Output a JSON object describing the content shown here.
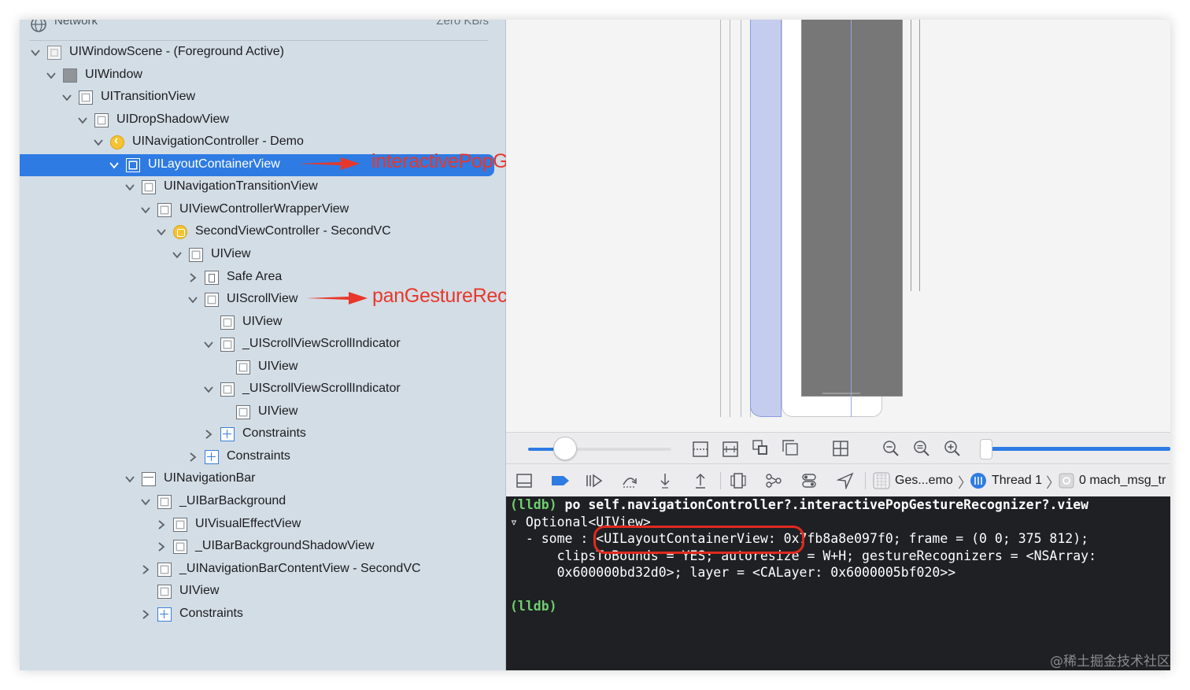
{
  "navigator": {
    "header_label": "Network",
    "header_value": "Zero KB/s",
    "tree": [
      {
        "label": "UIWindowScene - (Foreground Active)",
        "icon": "scene-square",
        "disclosure": "expanded",
        "selected": false
      },
      {
        "label": "UIWindow",
        "icon": "window-square",
        "disclosure": "expanded",
        "selected": false
      },
      {
        "label": "UITransitionView",
        "icon": "view-square",
        "disclosure": "expanded",
        "selected": false
      },
      {
        "label": "UIDropShadowView",
        "icon": "view-square",
        "disclosure": "expanded",
        "selected": false
      },
      {
        "label": "UINavigationController - Demo",
        "icon": "navigation-controller-icon",
        "disclosure": "expanded",
        "selected": false
      },
      {
        "label": "UILayoutContainerView",
        "icon": "view-square",
        "disclosure": "expanded",
        "selected": true
      },
      {
        "label": "UINavigationTransitionView",
        "icon": "view-square",
        "disclosure": "expanded",
        "selected": false
      },
      {
        "label": "UIViewControllerWrapperView",
        "icon": "view-square",
        "disclosure": "expanded",
        "selected": false
      },
      {
        "label": "SecondViewController - SecondVC",
        "icon": "view-controller-icon",
        "disclosure": "expanded",
        "selected": false
      },
      {
        "label": "UIView",
        "icon": "view-square",
        "disclosure": "expanded",
        "selected": false
      },
      {
        "label": "Safe Area",
        "icon": "safe-area-icon",
        "disclosure": "collapsed",
        "selected": false
      },
      {
        "label": "UIScrollView",
        "icon": "view-square",
        "disclosure": "expanded",
        "selected": false
      },
      {
        "label": "UIView",
        "icon": "view-square",
        "disclosure": "none",
        "selected": false
      },
      {
        "label": "_UIScrollViewScrollIndicator",
        "icon": "view-square",
        "disclosure": "expanded",
        "selected": false
      },
      {
        "label": "UIView",
        "icon": "view-square",
        "disclosure": "none",
        "selected": false
      },
      {
        "label": "_UIScrollViewScrollIndicator",
        "icon": "view-square",
        "disclosure": "expanded",
        "selected": false
      },
      {
        "label": "UIView",
        "icon": "view-square",
        "disclosure": "none",
        "selected": false
      },
      {
        "label": "Constraints",
        "icon": "constraints-icon",
        "disclosure": "collapsed",
        "selected": false
      },
      {
        "label": "Constraints",
        "icon": "constraints-icon",
        "disclosure": "collapsed",
        "selected": false
      },
      {
        "label": "UINavigationBar",
        "icon": "navigation-bar-icon",
        "disclosure": "expanded",
        "selected": false
      },
      {
        "label": "_UIBarBackground",
        "icon": "view-square",
        "disclosure": "expanded",
        "selected": false
      },
      {
        "label": "UIVisualEffectView",
        "icon": "view-square",
        "disclosure": "collapsed",
        "selected": false
      },
      {
        "label": "_UIBarBackgroundShadowView",
        "icon": "view-square",
        "disclosure": "collapsed",
        "selected": false
      },
      {
        "label": "_UINavigationBarContentView - SecondVC",
        "icon": "view-square",
        "disclosure": "collapsed",
        "selected": false
      },
      {
        "label": "UIView",
        "icon": "view-square",
        "disclosure": "none",
        "selected": false
      },
      {
        "label": "Constraints",
        "icon": "constraints-icon",
        "disclosure": "collapsed",
        "selected": false
      }
    ]
  },
  "annotations": {
    "first": "interactivePopGestureRecognizer",
    "second": "panGestureRecognizer"
  },
  "zoom_bar": {
    "zoom_level": 0.25,
    "icons": [
      "orient-vertical-icon",
      "orient-horizontal-icon",
      "show-clipped-icon",
      "show-constraints-icon",
      "layout-grid-icon",
      "zoom-out-icon",
      "zoom-actual-icon",
      "zoom-in-icon"
    ]
  },
  "debug_bar": {
    "icons": [
      "hide-debug-area-icon",
      "breakpoints-toggle-icon",
      "continue-icon",
      "step-over-icon",
      "step-into-icon",
      "step-out-icon",
      "view-debugger-icon",
      "memory-graph-icon",
      "environment-overrides-icon",
      "simulate-location-icon"
    ],
    "breadcrumb": {
      "target": "Ges...emo",
      "thread": "Thread 1",
      "frame": "0 mach_msg_tr"
    }
  },
  "console": {
    "prompt": "(lldb)",
    "command": "po self.navigationController?.interactivePopGestureRecognizer?.view",
    "output_line_1": "▿ Optional<UIView>",
    "output_line_2": "  - some : <UILayoutContainerView: 0x7fb8a8e097f0; frame = (0 0; 375 812);",
    "output_line_3": "      clipsToBounds = YES; autoresize = W+H; gestureRecognizers = <NSArray:",
    "output_line_4": "      0x600000bd32d0>; layer = <CALayer: 0x6000005bf020>>",
    "prompt_2": "(lldb)"
  },
  "watermark": "@稀土掘金技术社区",
  "colors": {
    "selection": "#2e7be3",
    "annotation": "#e8372a",
    "console_bg": "#1f2024",
    "prompt": "#6fcf6f"
  }
}
